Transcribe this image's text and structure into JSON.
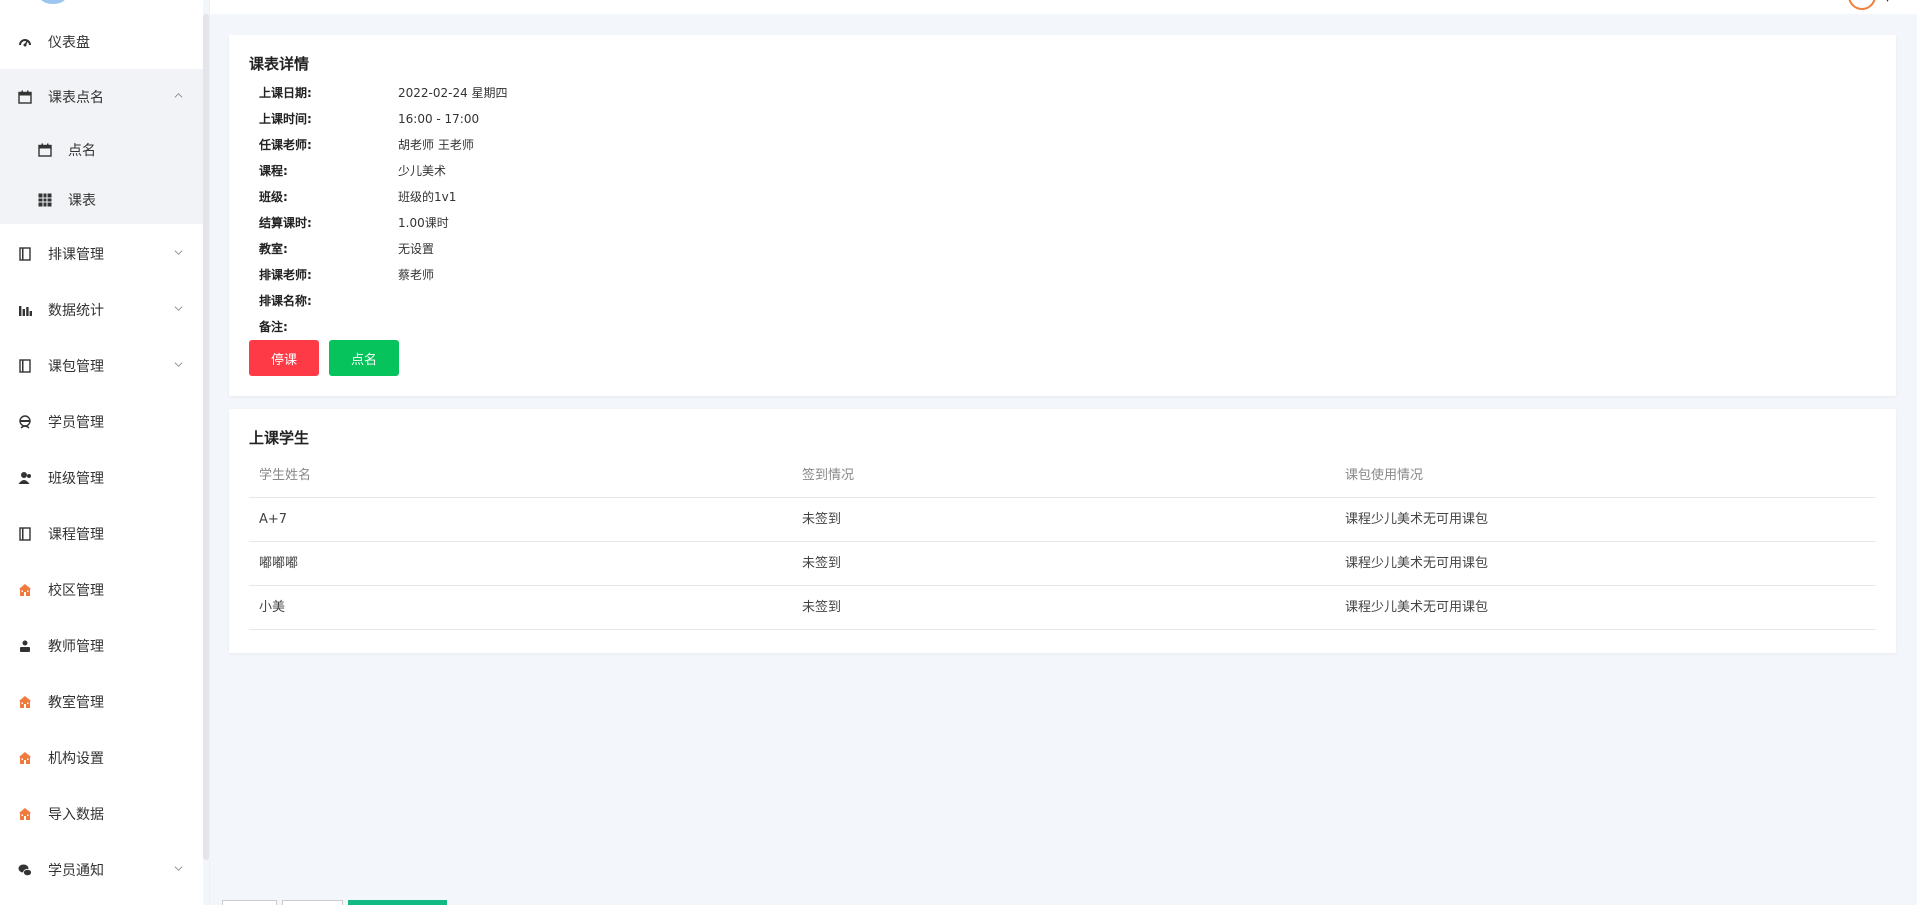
{
  "sidebar": {
    "items": [
      {
        "label": "仪表盘",
        "icon": "dashboard-icon",
        "glyph": "◔"
      },
      {
        "label": "课表点名",
        "icon": "calendar-icon",
        "glyph": "▦",
        "expanded": true
      },
      {
        "label": "排课管理",
        "icon": "book-icon",
        "glyph": "▯"
      },
      {
        "label": "数据统计",
        "icon": "bar-chart-icon",
        "glyph": "▮"
      },
      {
        "label": "课包管理",
        "icon": "book-icon",
        "glyph": "▯"
      },
      {
        "label": "学员管理",
        "icon": "student-icon",
        "glyph": "☺"
      },
      {
        "label": "班级管理",
        "icon": "users-icon",
        "glyph": "♟"
      },
      {
        "label": "课程管理",
        "icon": "book-icon",
        "glyph": "▯"
      },
      {
        "label": "校区管理",
        "icon": "school-icon",
        "glyph": "⌂"
      },
      {
        "label": "教师管理",
        "icon": "teacher-icon",
        "glyph": "♙"
      },
      {
        "label": "教室管理",
        "icon": "school-icon",
        "glyph": "⌂"
      },
      {
        "label": "机构设置",
        "icon": "school-icon",
        "glyph": "⌂"
      },
      {
        "label": "导入数据",
        "icon": "school-icon",
        "glyph": "⌂"
      },
      {
        "label": "学员通知",
        "icon": "wechat-icon",
        "glyph": "✉"
      }
    ],
    "sub_items": [
      {
        "label": "点名",
        "icon": "calendar-check-icon"
      },
      {
        "label": "课表",
        "icon": "table-grid-icon"
      }
    ]
  },
  "detail": {
    "title": "课表详情",
    "rows": [
      {
        "key": "上课日期:",
        "value": "2022-02-24 星期四"
      },
      {
        "key": "上课时间:",
        "value": "16:00 - 17:00"
      },
      {
        "key": "任课老师:",
        "value": "胡老师 王老师"
      },
      {
        "key": "课程:",
        "value": "少儿美术"
      },
      {
        "key": "班级:",
        "value": "班级的1v1"
      },
      {
        "key": "结算课时:",
        "value": "1.00课时"
      },
      {
        "key": "教室:",
        "value": "无设置"
      },
      {
        "key": "排课老师:",
        "value": "蔡老师"
      },
      {
        "key": "排课名称:",
        "value": ""
      },
      {
        "key": "备注:",
        "value": ""
      }
    ],
    "stop_button": "停课",
    "attendance_button": "点名"
  },
  "students": {
    "title": "上课学生",
    "columns": [
      "学生姓名",
      "签到情况",
      "课包使用情况"
    ],
    "rows": [
      [
        "A+7",
        "未签到",
        "课程少儿美术无可用课包"
      ],
      [
        "嘟嘟嘟",
        "未签到",
        "课程少儿美术无可用课包"
      ],
      [
        "小美",
        "未签到",
        "课程少儿美术无可用课包"
      ]
    ]
  },
  "colors": {
    "stop": "#ff3a47",
    "attendance": "#06c35b",
    "accent": "#13b982",
    "school_icon": "#f07a3c"
  }
}
